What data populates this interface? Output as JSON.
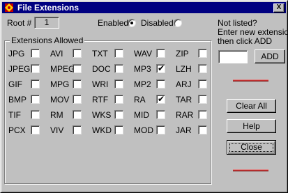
{
  "window": {
    "title": "File Extensions",
    "close_label": "X"
  },
  "root": {
    "label": "Root #",
    "value": "1"
  },
  "mode": {
    "enabled_label": "Enabled",
    "disabled_label": "Disabled",
    "selected": "Enabled"
  },
  "extensions": {
    "group_label": "Extensions Allowed",
    "columns": [
      [
        {
          "label": "JPG",
          "checked": false
        },
        {
          "label": "JPEG",
          "checked": false
        },
        {
          "label": "GIF",
          "checked": false
        },
        {
          "label": "BMP",
          "checked": false
        },
        {
          "label": "TIF",
          "checked": false
        },
        {
          "label": "PCX",
          "checked": false
        }
      ],
      [
        {
          "label": "AVI",
          "checked": false
        },
        {
          "label": "MPEG",
          "checked": false
        },
        {
          "label": "MPG",
          "checked": false
        },
        {
          "label": "MOV",
          "checked": false
        },
        {
          "label": "RM",
          "checked": false
        },
        {
          "label": "VIV",
          "checked": false
        }
      ],
      [
        {
          "label": "TXT",
          "checked": false
        },
        {
          "label": "DOC",
          "checked": false
        },
        {
          "label": "WRI",
          "checked": false
        },
        {
          "label": "RTF",
          "checked": false
        },
        {
          "label": "WKS",
          "checked": false
        },
        {
          "label": "WKD",
          "checked": false
        }
      ],
      [
        {
          "label": "WAV",
          "checked": false
        },
        {
          "label": "MP3",
          "checked": true
        },
        {
          "label": "MP2",
          "checked": false
        },
        {
          "label": "RA",
          "checked": true
        },
        {
          "label": "MID",
          "checked": false
        },
        {
          "label": "MOD",
          "checked": false
        }
      ],
      [
        {
          "label": "ZIP",
          "checked": false
        },
        {
          "label": "LZH",
          "checked": false
        },
        {
          "label": "ARJ",
          "checked": false
        },
        {
          "label": "TAR",
          "checked": false
        },
        {
          "label": "RAR",
          "checked": false
        },
        {
          "label": "JAR",
          "checked": false
        }
      ]
    ]
  },
  "not_listed": {
    "line1": "Not listed?",
    "line2": "Enter new extension,",
    "line3": "then click ADD",
    "input_value": "",
    "add_label": "ADD"
  },
  "buttons": {
    "clear_all": "Clear All",
    "help": "Help",
    "close": "Close"
  },
  "colors": {
    "titlebar": "#000080",
    "face": "#c0c0c0",
    "separator_red": "#c03030"
  }
}
